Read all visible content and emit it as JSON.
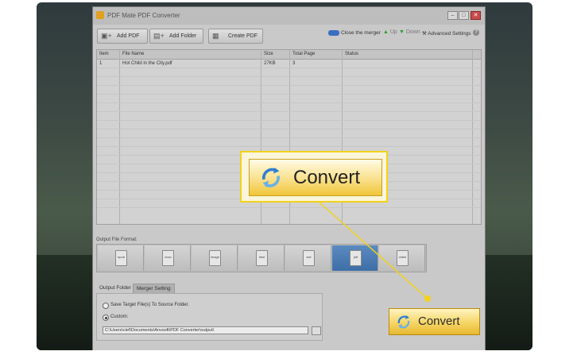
{
  "app": {
    "title": "PDF Mate PDF Converter"
  },
  "toolbar": {
    "add_pdf": "Add PDF",
    "add_folder": "Add Folder",
    "create_pdf": "Create PDF",
    "close_merger": "Close the merger",
    "up": "Up",
    "down": "Down",
    "advanced_settings": "Advanced Settings"
  },
  "file_table": {
    "headers": [
      "Item",
      "File Name",
      "Size",
      "Total Page",
      "Status"
    ],
    "rows": [
      {
        "item": "1",
        "file_name": "Hot Child in the City.pdf",
        "size": "27KB",
        "total_page": "3",
        "status": ""
      }
    ]
  },
  "output_format": {
    "label": "Output File Format:",
    "formats": [
      "epub",
      "docx",
      "image",
      "html",
      "swf",
      "pdf",
      "xhtml"
    ],
    "selected": "pdf"
  },
  "output_tabs": {
    "output_folder": "Output Folder",
    "merger_setting": "Merger Setting"
  },
  "output_options": {
    "save_to_source": "Save Target File(s) To Source Folder.",
    "custom": "Custom:",
    "custom_path": "C:\\Users\\clef\\Documents\\Anvsoft\\PDF Converter\\output\\",
    "selected": "custom"
  },
  "convert": {
    "label": "Convert",
    "callout_label": "Convert"
  },
  "colors": {
    "callout_border": "#f2d21b",
    "selected_format": "#3e6ea6",
    "convert_button": "#f6d566"
  },
  "icons": {
    "add_pdf": "add-pdf-icon",
    "add_folder": "add-folder-icon",
    "create_pdf": "create-pdf-icon",
    "convert": "convert-arrows-icon"
  }
}
